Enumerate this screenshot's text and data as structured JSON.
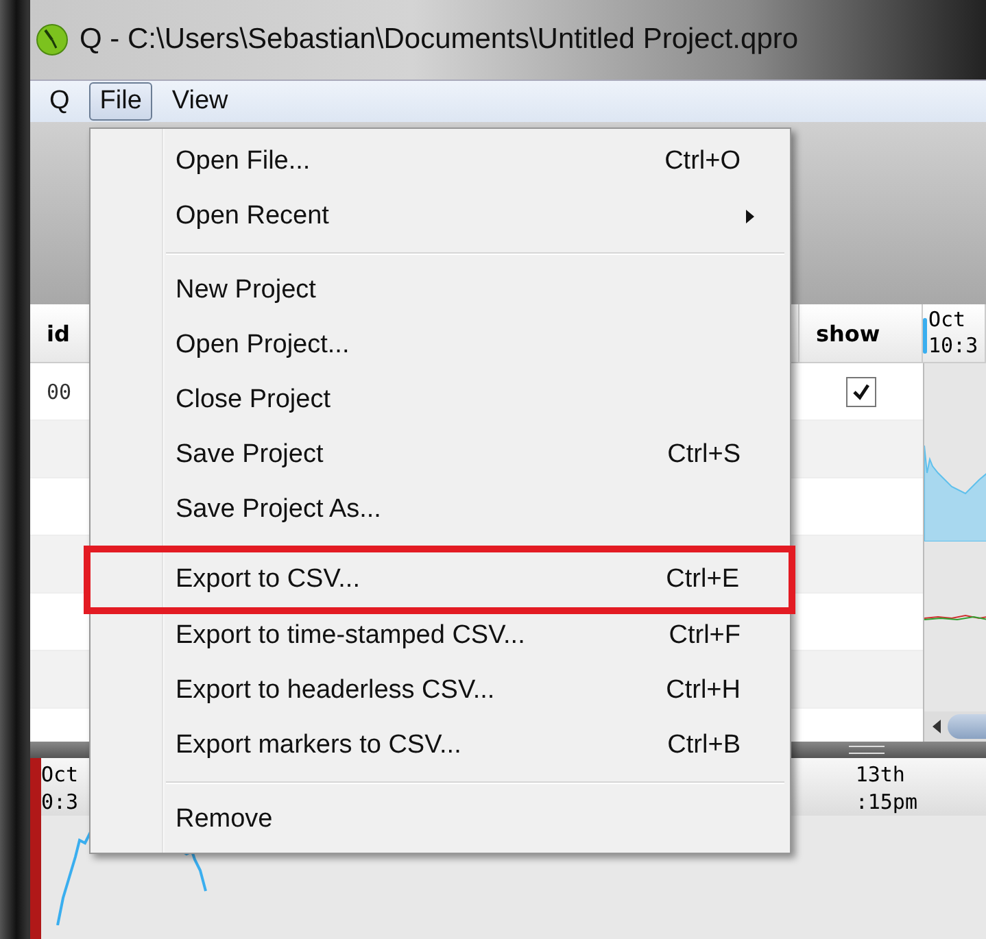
{
  "window": {
    "title": "Q  -  C:\\Users\\Sebastian\\Documents\\Untitled Project.qpro"
  },
  "menubar": [
    {
      "label": "Q",
      "selected": false
    },
    {
      "label": "File",
      "selected": true
    },
    {
      "label": "View",
      "selected": false
    }
  ],
  "file_menu": [
    {
      "kind": "item",
      "label": "Open File...",
      "shortcut": "Ctrl+O",
      "submenu": false,
      "highlighted": false
    },
    {
      "kind": "item",
      "label": "Open Recent",
      "submenu": true,
      "highlighted": false
    },
    {
      "kind": "separator"
    },
    {
      "kind": "item",
      "label": "New Project",
      "submenu": false,
      "highlighted": false
    },
    {
      "kind": "item",
      "label": "Open Project...",
      "submenu": false,
      "highlighted": false
    },
    {
      "kind": "item",
      "label": "Close Project",
      "submenu": false,
      "highlighted": false
    },
    {
      "kind": "item",
      "label": "Save Project",
      "shortcut": "Ctrl+S",
      "submenu": false,
      "highlighted": false
    },
    {
      "kind": "item",
      "label": "Save Project As...",
      "submenu": false,
      "highlighted": false
    },
    {
      "kind": "separator"
    },
    {
      "kind": "item",
      "label": "Export to CSV...",
      "shortcut": "Ctrl+E",
      "submenu": false,
      "highlighted": true
    },
    {
      "kind": "item",
      "label": "Export to time-stamped CSV...",
      "shortcut": "Ctrl+F",
      "submenu": false,
      "highlighted": false
    },
    {
      "kind": "item",
      "label": "Export to headerless CSV...",
      "shortcut": "Ctrl+H",
      "submenu": false,
      "highlighted": false
    },
    {
      "kind": "item",
      "label": "Export markers to CSV...",
      "shortcut": "Ctrl+B",
      "submenu": false,
      "highlighted": false
    },
    {
      "kind": "separator"
    },
    {
      "kind": "item",
      "label": "Remove",
      "submenu": false,
      "highlighted": false
    }
  ],
  "table": {
    "columns": [
      "id",
      "show"
    ],
    "timeline": [
      "Oct",
      "10:3"
    ],
    "rows": [
      {
        "id": "00",
        "show": true
      }
    ]
  },
  "bottom_timeline": {
    "start": [
      "Oct",
      "0:3"
    ],
    "end": [
      "13th",
      ":15pm"
    ]
  }
}
